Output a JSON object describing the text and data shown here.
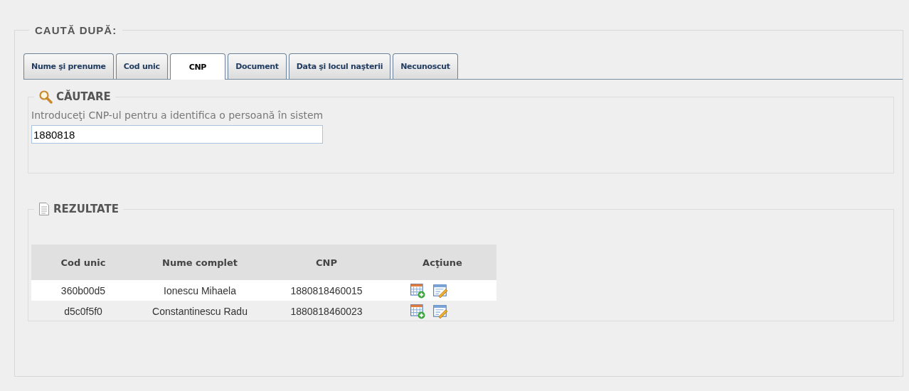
{
  "search_by": {
    "title": "CAUTĂ DUPĂ:",
    "tabs": [
      {
        "label": "Nume şi prenume",
        "selected": false
      },
      {
        "label": "Cod unic",
        "selected": false
      },
      {
        "label": "CNP",
        "selected": true
      },
      {
        "label": "Document",
        "selected": false
      },
      {
        "label": "Data şi locul naşterii",
        "selected": false
      },
      {
        "label": "Necunoscut",
        "selected": false
      }
    ]
  },
  "search": {
    "title": "CĂUTARE",
    "instruction": "Introduceţi CNP-ul pentru a identifica o persoană în sistem",
    "value": "1880818"
  },
  "results": {
    "title": "REZULTATE",
    "columns": [
      "Cod unic",
      "Nume complet",
      "CNP",
      "Acţiune"
    ],
    "rows": [
      {
        "code": "360b00d5",
        "name": "Ionescu Mihaela",
        "cnp": "1880818460015"
      },
      {
        "code": "d5c0f5f0",
        "name": "Constantinescu Radu",
        "cnp": "1880818460023"
      }
    ]
  }
}
